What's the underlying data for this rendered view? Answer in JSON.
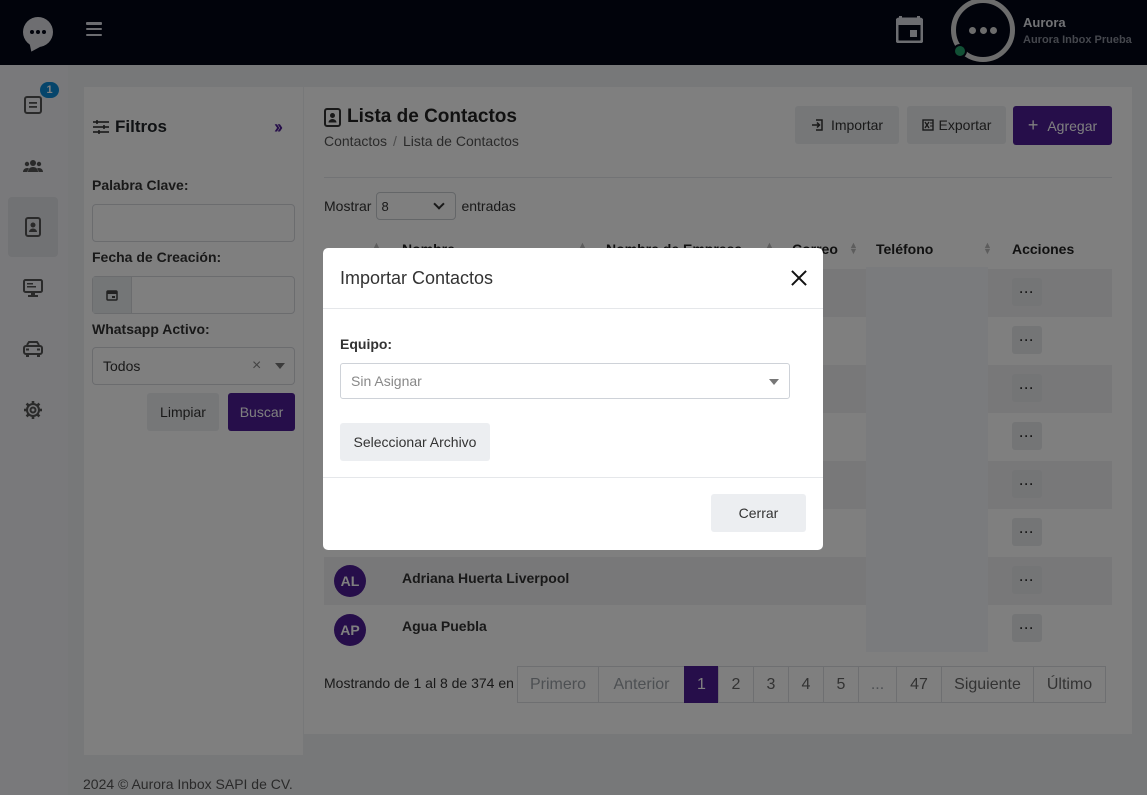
{
  "header": {
    "user_name": "Aurora",
    "user_org": "Aurora Inbox Prueba"
  },
  "sidebar": {
    "badge_count": "1",
    "items": [
      "inbox-icon",
      "users-icon",
      "contacts-icon",
      "monitor-icon",
      "car-icon",
      "gear-icon"
    ]
  },
  "filters": {
    "title": "Filtros",
    "keyword_label": "Palabra Clave:",
    "keyword_value": "",
    "date_label": "Fecha de Creación:",
    "date_value": "",
    "whatsapp_label": "Whatsapp Activo:",
    "whatsapp_value": "Todos",
    "clear_label": "Limpiar",
    "search_label": "Buscar"
  },
  "main": {
    "title": "Lista de Contactos",
    "breadcrumb": [
      "Contactos",
      "Lista de Contactos"
    ],
    "import_label": "Importar",
    "export_label": "Exportar",
    "add_label": "Agregar",
    "show_label": "Mostrar",
    "show_value": "8",
    "entries_label": "entradas",
    "columns": [
      "Nombre",
      "Nombre de Empresa",
      "Correo",
      "Teléfono",
      "Acciones"
    ],
    "rows": [
      {
        "initials": "",
        "name": ""
      },
      {
        "initials": "",
        "name": ""
      },
      {
        "initials": "",
        "name": ""
      },
      {
        "initials": "",
        "name": ""
      },
      {
        "initials": "",
        "name": ""
      },
      {
        "initials": "",
        "name": ""
      },
      {
        "initials": "AL",
        "name": "Adriana Huerta Liverpool"
      },
      {
        "initials": "AP",
        "name": "Agua Puebla"
      }
    ],
    "actions_label": "···",
    "info": "Mostrando de 1 al 8 de 374 en",
    "pagination": [
      "Primero",
      "Anterior",
      "1",
      "2",
      "3",
      "4",
      "5",
      "...",
      "47",
      "Siguiente",
      "Último"
    ],
    "current_page": "1"
  },
  "modal": {
    "title": "Importar Contactos",
    "team_label": "Equipo:",
    "team_placeholder": "Sin Asignar",
    "file_button": "Seleccionar Archivo",
    "close_button": "Cerrar"
  },
  "footer": {
    "text": "2024 © Aurora Inbox SAPI de CV."
  },
  "colors": {
    "brand": "#4c1d95",
    "topbar": "#020617",
    "badge": "#0d8bd6",
    "online": "#22a06b"
  }
}
